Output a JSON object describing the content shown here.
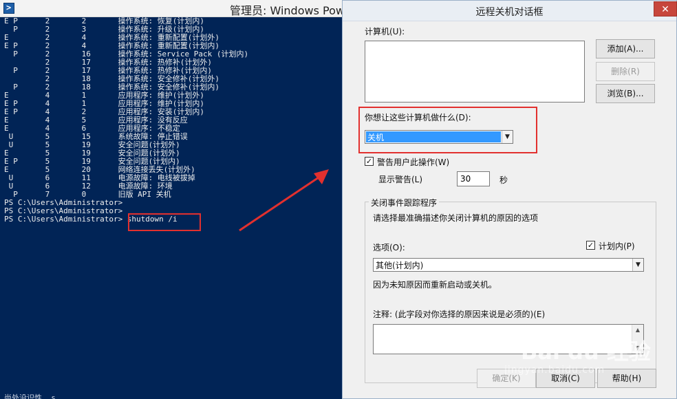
{
  "powershell": {
    "title": "管理员: Windows Powe",
    "lines": [
      "E P      2       2       操作系统: 恢复(计划内)",
      "  P      2       3       操作系统: 升级(计划内)",
      "E        2       4       操作系统: 重新配置(计划外)",
      "E P      2       4       操作系统: 重新配置(计划内)",
      "  P      2       16      操作系统: Service Pack (计划内)",
      "         2       17      操作系统: 热修补(计划外)",
      "  P      2       17      操作系统: 热修补(计划内)",
      "         2       18      操作系统: 安全修补(计划外)",
      "  P      2       18      操作系统: 安全修补(计划内)",
      "E        4       1       应用程序: 维护(计划外)",
      "E P      4       1       应用程序: 维护(计划内)",
      "E P      4       2       应用程序: 安装(计划内)",
      "E        4       5       应用程序: 没有反应",
      "E        4       6       应用程序: 不稳定",
      " U       5       15      系统故障: 停止错误",
      " U       5       19      安全问题(计划外)",
      "E        5       19      安全问题(计划外)",
      "E P      5       19      安全问题(计划内)",
      "E        5       20      网络连接丢失(计划外)",
      " U       6       11      电源故障: 电线被拔掉",
      " U       6       12      电源故障: 环境",
      "  P      7       0       旧版 API 关机",
      "PS C:\\Users\\Administrator>",
      "PS C:\\Users\\Administrator>",
      "PS C:\\Users\\Administrator> shutdown /i"
    ],
    "bottom_fragment": "尚处没识性 .s. ."
  },
  "dialog": {
    "title": "远程关机对话框",
    "close_glyph": "✕",
    "computers_label": "计算机(U):",
    "add_button": "添加(A)...",
    "remove_button": "删除(R)",
    "browse_button": "浏览(B)...",
    "action_label": "你想让这些计算机做什么(D):",
    "action_value": "关机",
    "warn_label": "警告用户此操作(W)",
    "warn_checked": true,
    "display_warning_label": "显示警告(L)",
    "warning_seconds": "30",
    "seconds_unit": "秒",
    "tracker_group_label": "关闭事件跟踪程序",
    "tracker_instruction": "请选择最准确描述你关闭计算机的原因的选项",
    "option_label": "选项(O):",
    "planned_label": "计划内(P)",
    "planned_checked": true,
    "option_value": "其他(计划内)",
    "option_description": "因为未知原因而重新启动或关机。",
    "comment_label": "注释: (此字段对你选择的原因来说是必须的)(E)",
    "ok_button": "确定(K)",
    "cancel_button": "取消(C)",
    "help_button": "帮助(H)"
  },
  "watermark": {
    "brand": "Bai du 经验",
    "url": "jingyan.baidu.com"
  },
  "colors": {
    "ps_background": "#012456",
    "highlight_red": "#e2302e",
    "selection_blue": "#3399ff"
  }
}
